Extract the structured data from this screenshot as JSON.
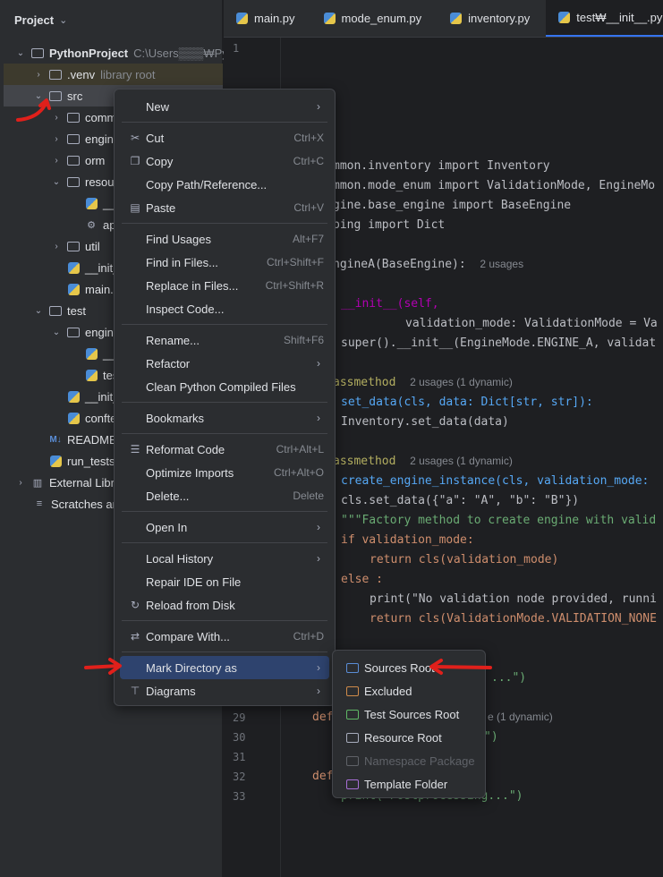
{
  "sidebar": {
    "title": "Project",
    "tree": [
      {
        "label": "PythonProject",
        "hint": "C:\\Users▒▒▒₩Py",
        "bold": true
      },
      {
        "label": ".venv",
        "hint": "library root"
      },
      {
        "label": "src"
      },
      {
        "label": "comm"
      },
      {
        "label": "engine"
      },
      {
        "label": "orm"
      },
      {
        "label": "resour"
      },
      {
        "label": "__i"
      },
      {
        "label": "ap"
      },
      {
        "label": "util"
      },
      {
        "label": "__init_"
      },
      {
        "label": "main.p"
      },
      {
        "label": "test"
      },
      {
        "label": "engine"
      },
      {
        "label": "__i"
      },
      {
        "label": "tes"
      },
      {
        "label": "__init_"
      },
      {
        "label": "conftes"
      },
      {
        "label": "README."
      },
      {
        "label": "run_tests."
      },
      {
        "label": "External Libra"
      },
      {
        "label": "Scratches and"
      }
    ]
  },
  "tabs": [
    "main.py",
    "mode_enum.py",
    "inventory.py",
    "test₩__init__.py"
  ],
  "line_numbers": [
    "1",
    "29",
    "30",
    "31",
    "32",
    "33"
  ],
  "code": {
    "l1": "mmon.inventory import Inventory",
    "l2": "mmon.mode_enum import ValidationMode, EngineMo",
    "l3": "gine.base_engine import BaseEngine",
    "l4": "ping import Dict",
    "l5a": "ngineA(BaseEngine):",
    "l5b": "2 usages",
    "l6": "__init__(self,",
    "l7": "validation_mode: ValidationMode = Va",
    "l8": "super().__init__(EngineMode.ENGINE_A, validat",
    "l9a": "assmethod",
    "l9b": "2 usages (1 dynamic)",
    "l10": "set_data(cls, data: Dict[str, str]):",
    "l11": "Inventory.set_data(data)",
    "l12a": "assmethod",
    "l12b": "2 usages (1 dynamic)",
    "l13": "create_engine_instance(cls, validation_mode:",
    "l14": "cls.set_data({\"a\": \"A\", \"b\": \"B\"})",
    "l15": "\"\"\"Factory method to create engine with valid",
    "l16": "if validation_mode:",
    "l17": "return cls(validation_mode)",
    "l18": "else :",
    "l19": "print(\"No validation node provided, runni",
    "l20": "return cls(ValidationMode.VALIDATION_NONE",
    "l21": "...\")",
    "l22": "def",
    "l22b": "e (1 dynamic)",
    "l23": "\")",
    "l24": "def",
    "l25": "print(\"Postprocessing...\")"
  },
  "menu": {
    "items": [
      {
        "label": "New",
        "shortcut": "",
        "submenu": true,
        "icon": ""
      },
      {
        "label": "Cut",
        "shortcut": "Ctrl+X",
        "icon": "scissors-icon"
      },
      {
        "label": "Copy",
        "shortcut": "Ctrl+C",
        "icon": "copy-icon"
      },
      {
        "label": "Copy Path/Reference...",
        "shortcut": ""
      },
      {
        "label": "Paste",
        "shortcut": "Ctrl+V",
        "icon": "paste-icon"
      },
      {
        "label": "Find Usages",
        "shortcut": "Alt+F7"
      },
      {
        "label": "Find in Files...",
        "shortcut": "Ctrl+Shift+F"
      },
      {
        "label": "Replace in Files...",
        "shortcut": "Ctrl+Shift+R"
      },
      {
        "label": "Inspect Code...",
        "shortcut": ""
      },
      {
        "label": "Rename...",
        "shortcut": "Shift+F6"
      },
      {
        "label": "Refactor",
        "submenu": true
      },
      {
        "label": "Clean Python Compiled Files"
      },
      {
        "label": "Bookmarks",
        "submenu": true
      },
      {
        "label": "Reformat Code",
        "shortcut": "Ctrl+Alt+L",
        "icon": "reformat-icon"
      },
      {
        "label": "Optimize Imports",
        "shortcut": "Ctrl+Alt+O"
      },
      {
        "label": "Delete...",
        "shortcut": "Delete"
      },
      {
        "label": "Open In",
        "submenu": true
      },
      {
        "label": "Local History",
        "submenu": true
      },
      {
        "label": "Repair IDE on File"
      },
      {
        "label": "Reload from Disk",
        "icon": "reload-icon"
      },
      {
        "label": "Compare With...",
        "shortcut": "Ctrl+D",
        "icon": "compare-icon"
      },
      {
        "label": "Mark Directory as",
        "submenu": true
      },
      {
        "label": "Diagrams",
        "submenu": true,
        "icon": "diagrams-icon"
      }
    ]
  },
  "submenu": {
    "items": [
      {
        "label": "Sources Root",
        "color": "#5a8dd6"
      },
      {
        "label": "Excluded",
        "color": "#d08b4a"
      },
      {
        "label": "Test Sources Root",
        "color": "#5fb865"
      },
      {
        "label": "Resource Root",
        "color": "#a8adbd"
      },
      {
        "label": "Namespace Package",
        "color": "#5f6268",
        "disabled": true
      },
      {
        "label": "Template Folder",
        "color": "#a86fd6"
      }
    ]
  },
  "colors": {
    "accent": "#3574f0",
    "highlight": "#2e436e",
    "annotation": "#e0201b"
  }
}
